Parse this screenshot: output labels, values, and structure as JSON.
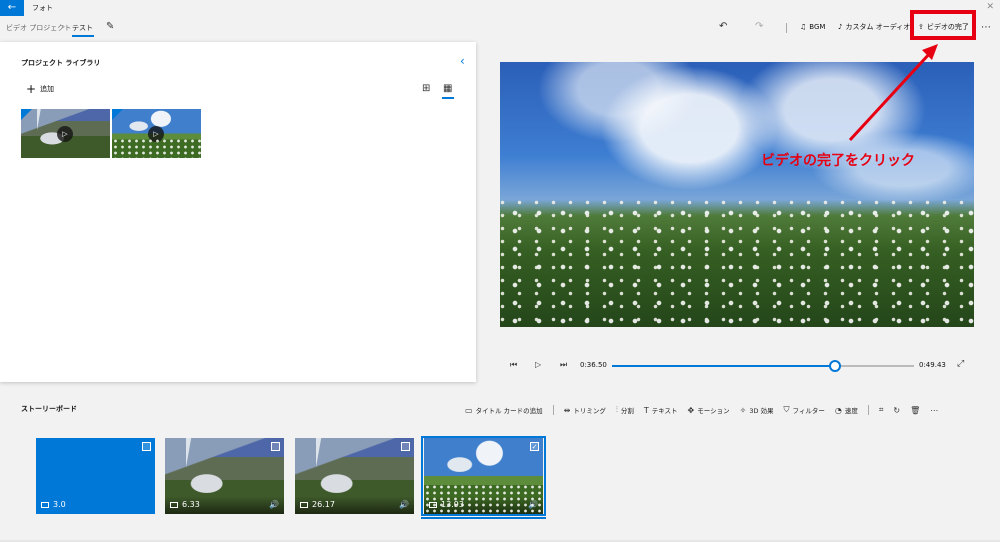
{
  "window": {
    "back_icon": "←",
    "app_title": "フォト",
    "close_icon": "✕"
  },
  "header": {
    "breadcrumb_root": "ビデオ プロジェクト",
    "breadcrumb_sep": "›",
    "breadcrumb_current": "テスト",
    "edit_icon": "✎",
    "undo_icon": "↶",
    "redo_icon": "↷",
    "bgm_icon": "♫",
    "bgm_label": "BGM",
    "custom_audio_icon": "♪",
    "custom_audio_label": "カスタム オーディオ",
    "finish_icon": "⇪",
    "finish_label": "ビデオの完了",
    "more_icon": "⋯"
  },
  "library": {
    "title": "プロジェクト ライブラリ",
    "collapse_icon": "‹",
    "add_icon": "+",
    "add_label": "追加",
    "view_large_icon": "⊞",
    "view_small_icon": "▦",
    "play_icon": "▷"
  },
  "annotation": {
    "label": "ビデオの完了をクリック",
    "color": "#e60012"
  },
  "playback": {
    "prev_icon": "⏮",
    "play_icon": "▷",
    "next_icon": "⏭",
    "current_time": "0:36.50",
    "total_time": "0:49.43",
    "progress": 0.738,
    "fullscreen_icon": "⤢"
  },
  "storyboard": {
    "title": "ストーリーボード",
    "toolbar": {
      "title_card_icon": "▭",
      "title_card": "タイトル カードの追加",
      "trim_icon": "⇹",
      "trim": "トリミング",
      "split_icon": "⫶",
      "split": "分割",
      "text_icon": "T",
      "text": "テキスト",
      "motion_icon": "✥",
      "motion": "モーション",
      "effects_icon": "✧",
      "effects": "3D 効果",
      "filters_icon": "⛉",
      "filters": "フィルター",
      "speed_icon": "◔",
      "speed": "速度",
      "resize_icon": "⌗",
      "rotate_icon": "↻",
      "delete_icon": "🗑",
      "more_icon": "⋯"
    },
    "clips": [
      {
        "duration": "3.0"
      },
      {
        "duration": "6.33",
        "audio_icon": "🔊"
      },
      {
        "duration": "26.17",
        "audio_icon": "🔊"
      },
      {
        "duration": "13.93",
        "audio_icon": "🔊",
        "selected_check": "✓"
      }
    ]
  },
  "colors": {
    "accent": "#0078d7",
    "highlight": "#e60012"
  }
}
